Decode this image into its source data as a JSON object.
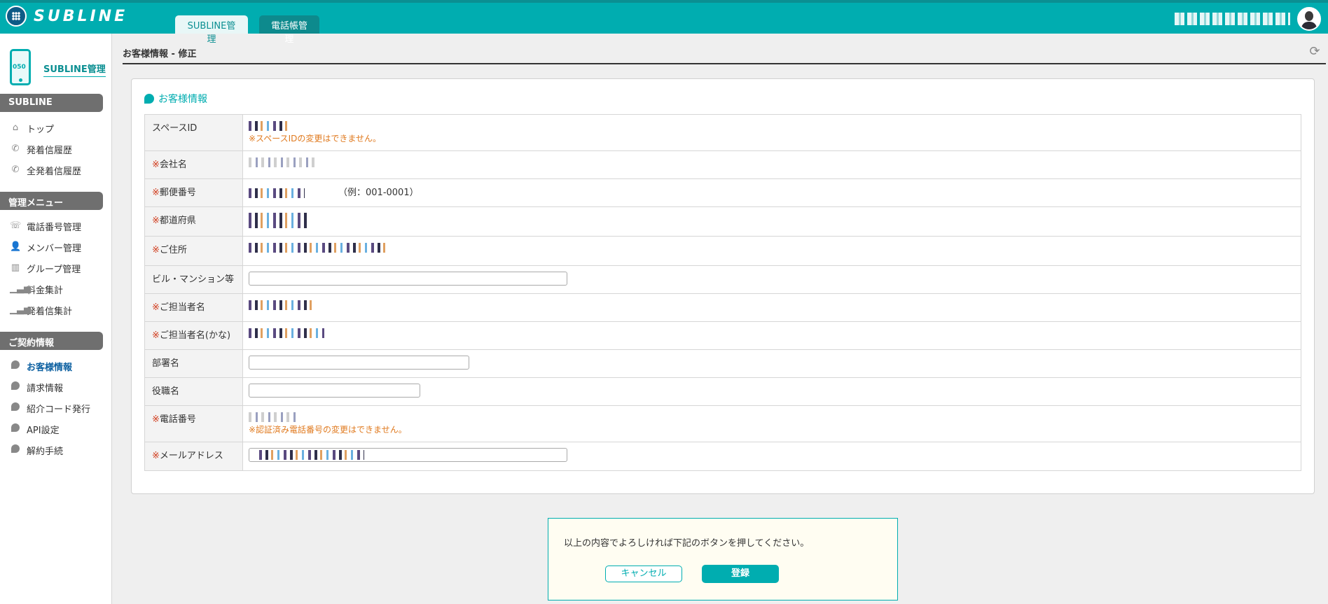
{
  "header": {
    "logo_text": "SUBLINE",
    "tabs": [
      {
        "label": "SUBLINE管理"
      },
      {
        "label": "電話帳管理"
      }
    ]
  },
  "sidebar": {
    "title": "SUBLINE管理",
    "phone_icon_text": "050",
    "sections": [
      {
        "label": "SUBLINE",
        "items": [
          {
            "label": "トップ"
          },
          {
            "label": "発着信履歴"
          },
          {
            "label": "全発着信履歴"
          }
        ]
      },
      {
        "label": "管理メニュー",
        "items": [
          {
            "label": "電話番号管理"
          },
          {
            "label": "メンバー管理"
          },
          {
            "label": "グループ管理"
          },
          {
            "label": "料金集計"
          },
          {
            "label": "発着信集計"
          }
        ]
      },
      {
        "label": "ご契約情報",
        "items": [
          {
            "label": "お客様情報"
          },
          {
            "label": "請求情報"
          },
          {
            "label": "紹介コード発行"
          },
          {
            "label": "API設定"
          },
          {
            "label": "解約手続"
          }
        ]
      }
    ]
  },
  "page": {
    "title": "お客様情報 - 修正"
  },
  "panel": {
    "title": "お客様情報",
    "fields": {
      "space_id": {
        "label": "スペースID",
        "note": "※スペースIDの変更はできません。"
      },
      "company": {
        "required": "※",
        "label": "会社名"
      },
      "postal": {
        "required": "※",
        "label": "郵便番号",
        "example": "（例：001-0001）"
      },
      "prefecture": {
        "required": "※",
        "label": "都道府県"
      },
      "address": {
        "required": "※",
        "label": "ご住所"
      },
      "building": {
        "label": "ビル・マンション等",
        "value": ""
      },
      "contact_name": {
        "required": "※",
        "label": "ご担当者名"
      },
      "contact_kana": {
        "required": "※",
        "label": "ご担当者名(かな)"
      },
      "department": {
        "label": "部署名",
        "value": ""
      },
      "position": {
        "label": "役職名",
        "value": ""
      },
      "phone": {
        "required": "※",
        "label": "電話番号",
        "note": "※認証済み電話番号の変更はできません。"
      },
      "email": {
        "required": "※",
        "label": "メールアドレス"
      }
    }
  },
  "confirm": {
    "message": "以上の内容でよろしければ下記のボタンを押してください。",
    "cancel_label": "キャンセル",
    "register_label": "登録"
  },
  "colors": {
    "brand": "#00adb0",
    "required": "#d03a1a",
    "note": "#e07a1f"
  }
}
